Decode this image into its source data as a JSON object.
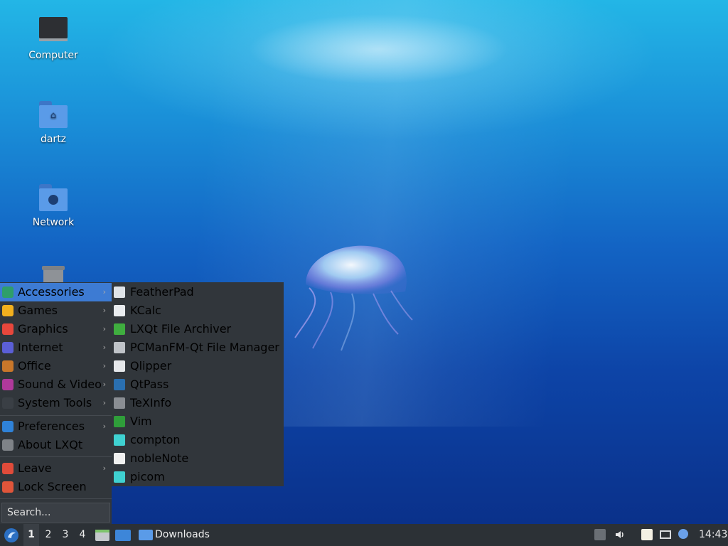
{
  "desktop": {
    "icons": [
      {
        "label": "Computer",
        "icon": "computer-icon"
      },
      {
        "label": "dartz",
        "icon": "home-folder-icon"
      },
      {
        "label": "Network",
        "icon": "network-folder-icon"
      },
      {
        "label": "",
        "icon": "trash-icon"
      }
    ]
  },
  "menu": {
    "categories": [
      {
        "label": "Accessories",
        "icon": "accessories-icon",
        "color": "#2e9e6a"
      },
      {
        "label": "Games",
        "icon": "games-icon",
        "color": "#f2b01e"
      },
      {
        "label": "Graphics",
        "icon": "graphics-icon",
        "color": "#e8473c"
      },
      {
        "label": "Internet",
        "icon": "internet-icon",
        "color": "#5b5fd6"
      },
      {
        "label": "Office",
        "icon": "office-icon",
        "color": "#c8772a"
      },
      {
        "label": "Sound & Video",
        "icon": "sound-video-icon",
        "color": "#b0399b"
      },
      {
        "label": "System Tools",
        "icon": "system-tools-icon",
        "color": "#3a3f45"
      },
      {
        "label": "Preferences",
        "icon": "preferences-icon",
        "color": "#2f82d8"
      },
      {
        "label": "About LXQt",
        "icon": "info-icon",
        "color": "#7f8388"
      },
      {
        "label": "Leave",
        "icon": "power-icon",
        "color": "#e04b3a"
      },
      {
        "label": "Lock Screen",
        "icon": "lock-icon",
        "color": "#e0553a"
      }
    ],
    "search_placeholder": "Search...",
    "arrow": "›"
  },
  "submenu": {
    "items": [
      {
        "label": "FeatherPad",
        "icon": "featherpad-icon",
        "color": "#dfe3e8"
      },
      {
        "label": "KCalc",
        "icon": "calculator-icon",
        "color": "#e9ecef"
      },
      {
        "label": "LXQt File Archiver",
        "icon": "archive-icon",
        "color": "#3fae3f"
      },
      {
        "label": "PCManFM-Qt File Manager",
        "icon": "file-manager-icon",
        "color": "#bfc3c8"
      },
      {
        "label": "Qlipper",
        "icon": "clipboard-icon",
        "color": "#e6e8eb"
      },
      {
        "label": "QtPass",
        "icon": "password-icon",
        "color": "#2a6fb0"
      },
      {
        "label": "TeXInfo",
        "icon": "info-icon",
        "color": "#8a8e93"
      },
      {
        "label": "Vim",
        "icon": "vim-icon",
        "color": "#2f9e3a"
      },
      {
        "label": "compton",
        "icon": "gear-icon",
        "color": "#3fd1d1"
      },
      {
        "label": "nobleNote",
        "icon": "note-icon",
        "color": "#f0f0f0"
      },
      {
        "label": "picom",
        "icon": "gear-icon",
        "color": "#3fd1d1"
      }
    ]
  },
  "taskbar": {
    "desktops": [
      "1",
      "2",
      "3",
      "4"
    ],
    "active_desktop": "1",
    "window_title": "Downloads",
    "clock": "14:43"
  },
  "colors": {
    "menu_bg": "#31363b",
    "highlight": "#3d7bd3",
    "taskbar_bg": "#2c3136"
  }
}
